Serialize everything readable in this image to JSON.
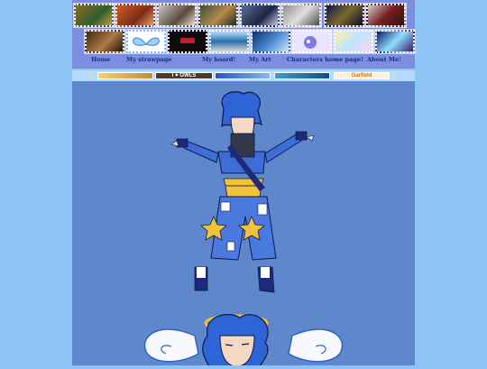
{
  "nav": {
    "items": [
      {
        "label": "Home"
      },
      {
        "label": "My strawpage"
      },
      {
        "label": "My hoard!"
      },
      {
        "label": "My Art"
      },
      {
        "label": "Characters home page!"
      },
      {
        "label": "About Me!"
      }
    ]
  },
  "banners": {
    "items": [
      {
        "label": ""
      },
      {
        "label": "I ♥ OWLS"
      },
      {
        "label": ""
      },
      {
        "label": ""
      },
      {
        "label": "Garfield"
      }
    ]
  },
  "colors": {
    "page_bg": "#8ec5f7",
    "header_bg": "#7d8ee0",
    "content_bg": "#5f88cc",
    "nav_text": "#1d2a7a"
  }
}
